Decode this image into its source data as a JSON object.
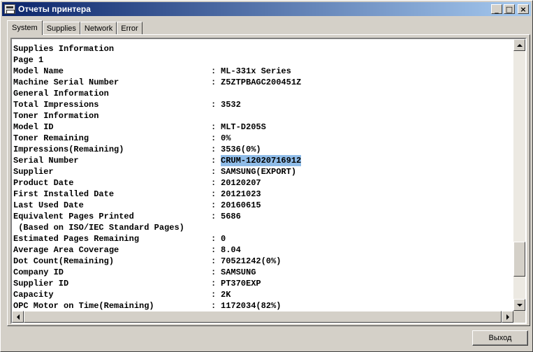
{
  "window": {
    "title": "Отчеты принтера",
    "minimize_label": "_",
    "maximize_label": "□",
    "close_label": "×"
  },
  "tabs": [
    {
      "label": "System",
      "active": true
    },
    {
      "label": "Supplies",
      "active": false
    },
    {
      "label": "Network",
      "active": false
    },
    {
      "label": "Error",
      "active": false
    }
  ],
  "report": {
    "lines": [
      {
        "label": "Supplies Information",
        "value": null
      },
      {
        "label": "Page 1",
        "value": null
      },
      {
        "label": "Model Name",
        "value": "ML-331x Series"
      },
      {
        "label": "Machine Serial Number",
        "value": "Z5ZTPBAGC200451Z"
      },
      {
        "label": "General Information",
        "value": null
      },
      {
        "label": "Total Impressions",
        "value": "3532"
      },
      {
        "label": "Toner Information",
        "value": null
      },
      {
        "label": "Model ID",
        "value": "MLT-D205S"
      },
      {
        "label": "Toner Remaining",
        "value": "0%"
      },
      {
        "label": "Impressions(Remaining)",
        "value": "3536(0%)"
      },
      {
        "label": "Serial Number",
        "value": "CRUM-12020716912",
        "selected": true
      },
      {
        "label": "Supplier",
        "value": "SAMSUNG(EXPORT)"
      },
      {
        "label": "Product Date",
        "value": "20120207"
      },
      {
        "label": "First Installed Date",
        "value": "20121023"
      },
      {
        "label": "Last Used Date",
        "value": "20160615"
      },
      {
        "label": "Equivalent Pages Printed",
        "value": "5686"
      },
      {
        "label": " (Based on ISO/IEC Standard Pages)",
        "value": null
      },
      {
        "label": "Estimated Pages Remaining",
        "value": "0"
      },
      {
        "label": "Average Area Coverage",
        "value": "8.04"
      },
      {
        "label": "Dot Count(Remaining)",
        "value": "70521242(0%)"
      },
      {
        "label": "Company ID",
        "value": "SAMSUNG"
      },
      {
        "label": "Supplier ID",
        "value": "PT370EXP"
      },
      {
        "label": "Capacity",
        "value": "2K"
      },
      {
        "label": "OPC Motor on Time(Remaining)",
        "value": "1172034(82%)"
      }
    ],
    "separator": ":"
  },
  "buttons": {
    "exit_label": "Выход"
  },
  "colors": {
    "selection": "#8fbce8",
    "titlebar_start": "#0a246a",
    "titlebar_end": "#a6caf0"
  }
}
